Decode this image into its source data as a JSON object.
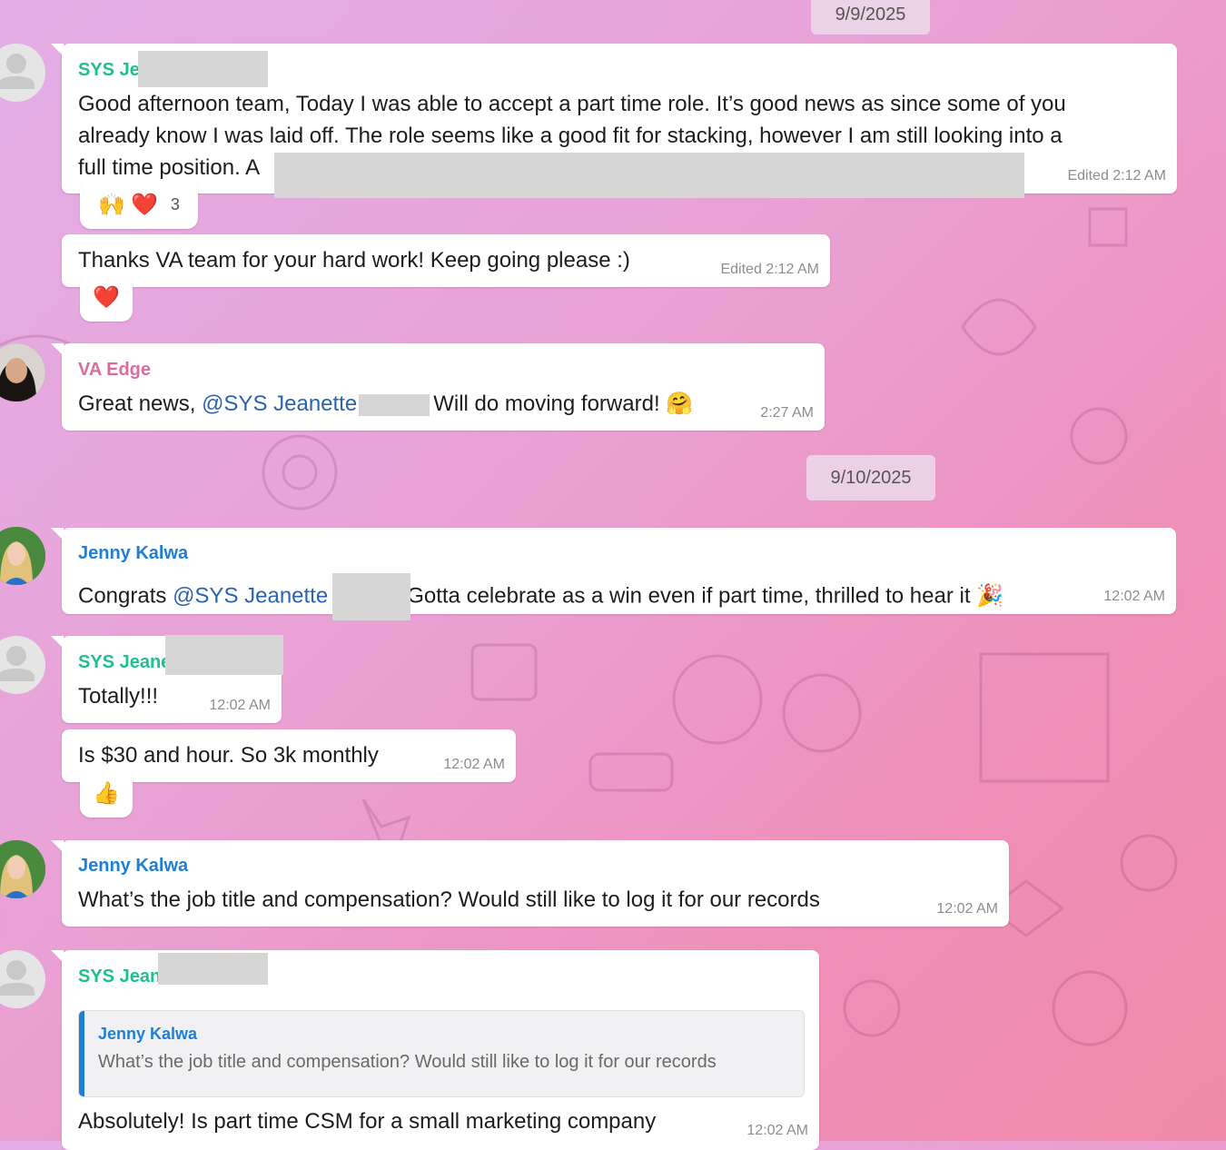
{
  "dates": [
    "9/9/2025",
    "9/10/2025"
  ],
  "messages": [
    {
      "sender": "SYS Jea",
      "lines": [
        "Good afternoon team, Today I was able to accept a part time role. It’s good news as since some of you",
        "already know I was laid off. The role seems like a good fit for stacking, however I am still looking into a",
        "full time position. A"
      ],
      "time": "Edited 2:12 AM",
      "reactions": {
        "emojis": [
          "🙌",
          "❤️"
        ],
        "count": "3"
      }
    },
    {
      "text": "Thanks VA team for your hard work! Keep going please :)",
      "time": "Edited 2:12 AM",
      "reactions": {
        "emojis": [
          "❤️"
        ]
      }
    },
    {
      "sender": "VA Edge",
      "text_before": "Great news, ",
      "mention": "@SYS Jeanette",
      "text_after": "Will do moving forward!",
      "emoji": "🤗",
      "time": "2:27 AM"
    },
    {
      "sender": "Jenny Kalwa",
      "text_before": "Congrats ",
      "mention": "@SYS Jeanette",
      "text_after": "Gotta celebrate as a  win even if part time, thrilled to  hear it",
      "emoji": "🎉",
      "time": "12:02 AM"
    },
    {
      "sender": "SYS Jeane",
      "text": "Totally!!!",
      "time": "12:02 AM"
    },
    {
      "text": "Is $30 and hour. So 3k monthly",
      "time": "12:02 AM",
      "reactions": {
        "emojis": [
          "👍"
        ]
      }
    },
    {
      "sender": "Jenny Kalwa",
      "text": "What’s the job title and compensation? Would still like to log it for our records",
      "time": "12:02 AM"
    },
    {
      "sender": "SYS Jean",
      "reply": {
        "name": "Jenny Kalwa",
        "text": "What’s the job title and compensation? Would still like to log it for our records"
      },
      "text": "Absolutely! Is part time CSM for a small marketing company",
      "time": "12:02 AM"
    }
  ]
}
